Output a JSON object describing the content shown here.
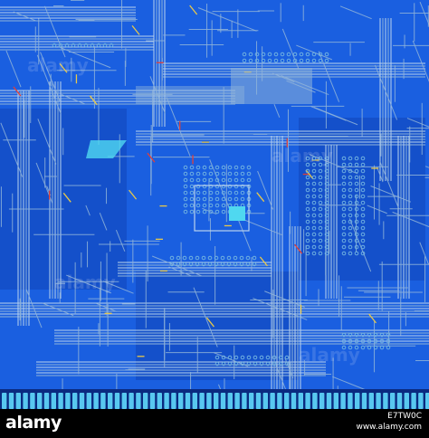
{
  "image": {
    "subject": "circuit board traces",
    "colors": {
      "substrate": "#1a5fe0",
      "substrate_dark": "#0d3fb0",
      "trace": "#8fb3d9",
      "trace_light": "#b9d3ee",
      "pad": "#6fb0e0",
      "highlight_cyan": "#4fd8f0",
      "accent_red": "#e0403a",
      "accent_yellow": "#e8c84a",
      "edge_connector": "#58c8f0"
    }
  },
  "footer": {
    "brand": "alamy",
    "image_id": "E7TW0C",
    "url": "www.alamy.com"
  },
  "watermarks": [
    "alamy",
    "alamy",
    "alamy",
    "alamy"
  ]
}
